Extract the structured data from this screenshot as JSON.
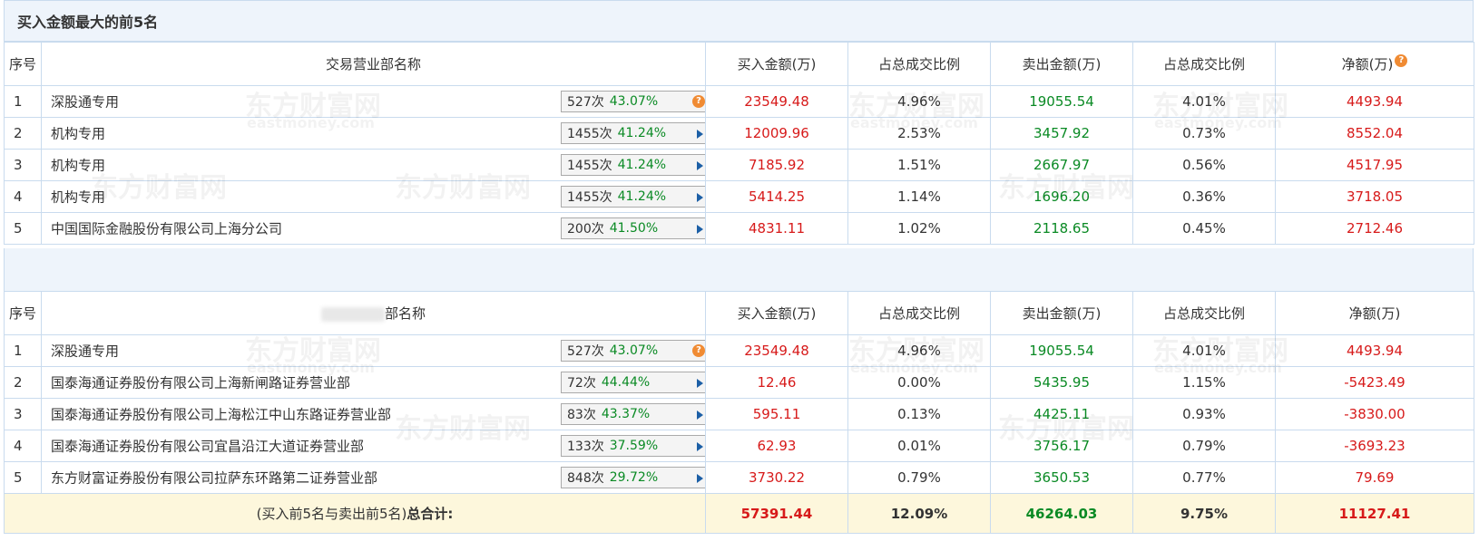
{
  "title": "买入金额最大的前5名",
  "columns": {
    "idx": "序号",
    "name": "交易营业部名称",
    "name_partial": "部名称",
    "buy": "买入金额(万)",
    "buy_ratio": "占总成交比例",
    "sell": "卖出金额(万)",
    "sell_ratio": "占总成交比例",
    "net": "净额(万)"
  },
  "icons": {
    "help": "?",
    "arrow": "right-arrow-icon"
  },
  "watermark": {
    "main": "东方财富网",
    "sub": "eastmoney.com"
  },
  "colors": {
    "buy": "#d71a1a",
    "sell": "#0a8a24",
    "header_bg": "#eef4fb",
    "total_bg": "#fdf7dc"
  },
  "buy_top5": [
    {
      "idx": "1",
      "name": "深股通专用",
      "count": "527次",
      "pct": "43.07%",
      "buy": "23549.48",
      "buy_ratio": "4.96%",
      "sell": "19055.54",
      "sell_ratio": "4.01%",
      "net": "4493.94"
    },
    {
      "idx": "2",
      "name": "机构专用",
      "count": "1455次",
      "pct": "41.24%",
      "buy": "12009.96",
      "buy_ratio": "2.53%",
      "sell": "3457.92",
      "sell_ratio": "0.73%",
      "net": "8552.04"
    },
    {
      "idx": "3",
      "name": "机构专用",
      "count": "1455次",
      "pct": "41.24%",
      "buy": "7185.92",
      "buy_ratio": "1.51%",
      "sell": "2667.97",
      "sell_ratio": "0.56%",
      "net": "4517.95"
    },
    {
      "idx": "4",
      "name": "机构专用",
      "count": "1455次",
      "pct": "41.24%",
      "buy": "5414.25",
      "buy_ratio": "1.14%",
      "sell": "1696.20",
      "sell_ratio": "0.36%",
      "net": "3718.05"
    },
    {
      "idx": "5",
      "name": "中国国际金融股份有限公司上海分公司",
      "count": "200次",
      "pct": "41.50%",
      "buy": "4831.11",
      "buy_ratio": "1.02%",
      "sell": "2118.65",
      "sell_ratio": "0.45%",
      "net": "2712.46"
    }
  ],
  "sell_top5": [
    {
      "idx": "1",
      "name": "深股通专用",
      "count": "527次",
      "pct": "43.07%",
      "buy": "23549.48",
      "buy_ratio": "4.96%",
      "sell": "19055.54",
      "sell_ratio": "4.01%",
      "net": "4493.94"
    },
    {
      "idx": "2",
      "name": "国泰海通证券股份有限公司上海新闸路证券营业部",
      "count": "72次",
      "pct": "44.44%",
      "buy": "12.46",
      "buy_ratio": "0.00%",
      "sell": "5435.95",
      "sell_ratio": "1.15%",
      "net": "-5423.49"
    },
    {
      "idx": "3",
      "name": "国泰海通证券股份有限公司上海松江中山东路证券营业部",
      "count": "83次",
      "pct": "43.37%",
      "buy": "595.11",
      "buy_ratio": "0.13%",
      "sell": "4425.11",
      "sell_ratio": "0.93%",
      "net": "-3830.00"
    },
    {
      "idx": "4",
      "name": "国泰海通证券股份有限公司宜昌沿江大道证券营业部",
      "count": "133次",
      "pct": "37.59%",
      "buy": "62.93",
      "buy_ratio": "0.01%",
      "sell": "3756.17",
      "sell_ratio": "0.79%",
      "net": "-3693.23"
    },
    {
      "idx": "5",
      "name": "东方财富证券股份有限公司拉萨东环路第二证券营业部",
      "count": "848次",
      "pct": "29.72%",
      "buy": "3730.22",
      "buy_ratio": "0.79%",
      "sell": "3650.53",
      "sell_ratio": "0.77%",
      "net": "79.69"
    }
  ],
  "total": {
    "label_prefix": "(买入前5名与卖出前5名)",
    "label_suffix": "总合计:",
    "buy": "57391.44",
    "buy_ratio": "12.09%",
    "sell": "46264.03",
    "sell_ratio": "9.75%",
    "net": "11127.41"
  }
}
